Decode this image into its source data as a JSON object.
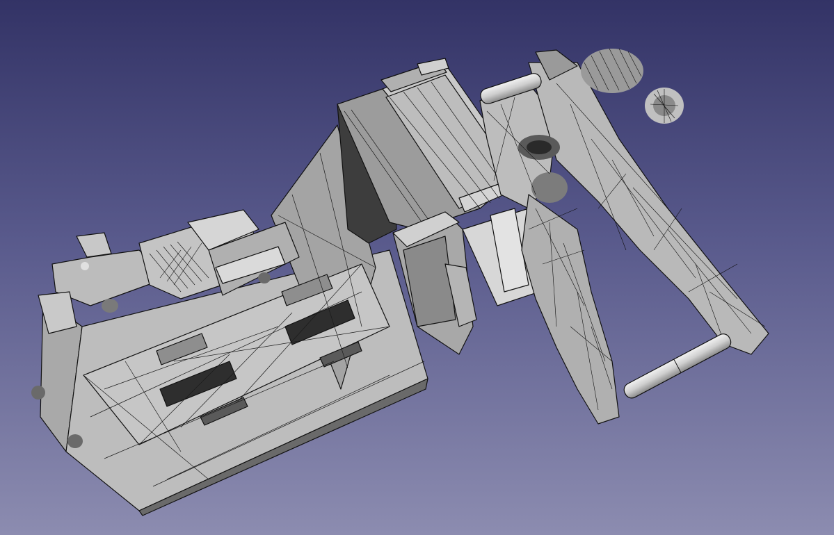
{
  "viewport": {
    "background_top": "#333366",
    "background_bottom": "#8c8cb0",
    "model_face": "#b8b8b8",
    "model_face_light": "#cfcfcf",
    "model_face_dark": "#6e6e6e",
    "edge_color": "#111111"
  },
  "model": {
    "display_mode": "wireframe-shaded"
  }
}
